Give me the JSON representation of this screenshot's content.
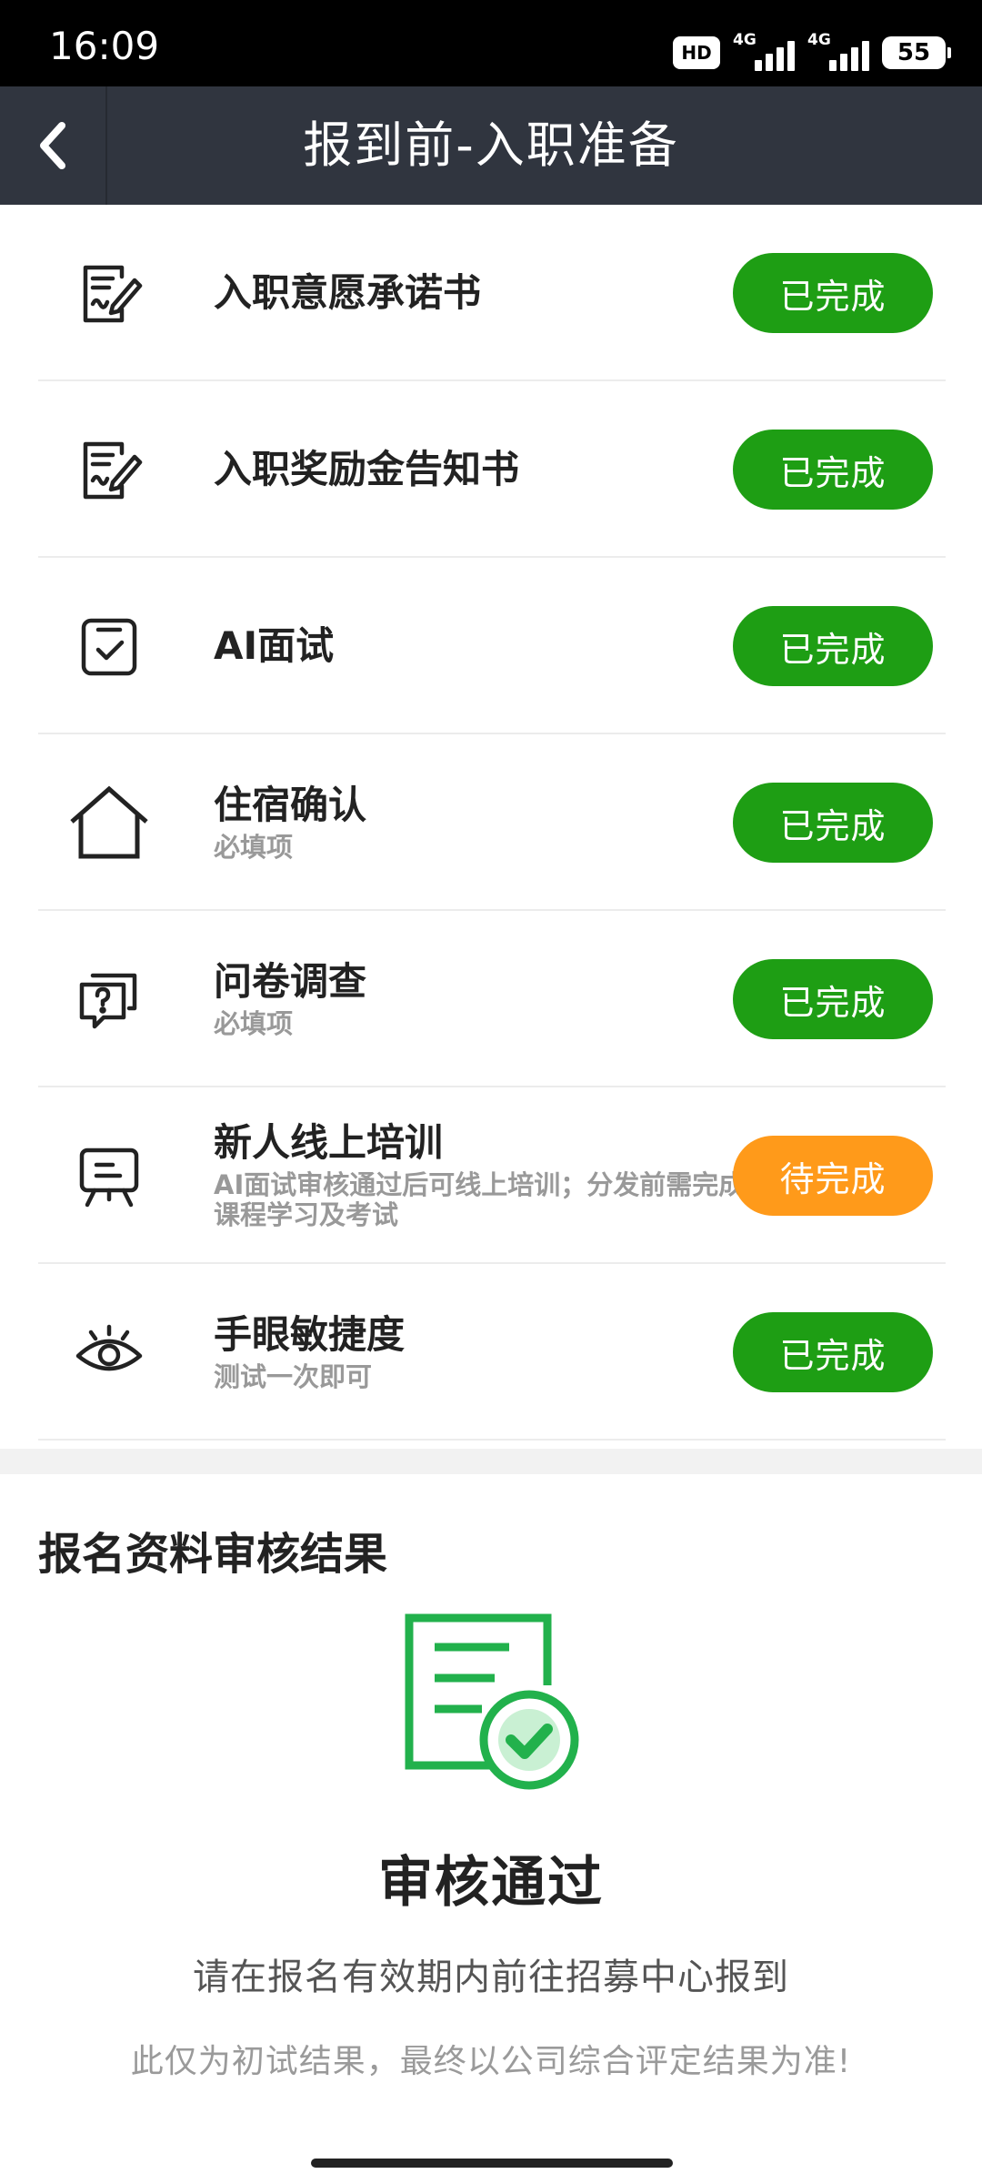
{
  "status_bar": {
    "time": "16:09",
    "hd_badge": "HD",
    "signal1_tag": "4G",
    "signal2_tag": "4G",
    "battery": "55",
    "icons": [
      "hd-icon",
      "signal-icon",
      "signal-icon",
      "battery-icon"
    ]
  },
  "nav": {
    "back_icon": "chevron-left-icon",
    "title": "报到前-入职准备"
  },
  "tasks": [
    {
      "title": "入职意愿承诺书",
      "subtitle": "",
      "status": "已完成",
      "icon": "document-sign-icon"
    },
    {
      "title": "入职奖励金告知书",
      "subtitle": "",
      "status": "已完成",
      "icon": "document-sign-icon"
    },
    {
      "title": "AI面试",
      "subtitle": "",
      "status": "已完成",
      "icon": "checkbox-icon"
    },
    {
      "title": "住宿确认",
      "subtitle": "必填项",
      "status": "已完成",
      "icon": "house-icon"
    },
    {
      "title": "问卷调查",
      "subtitle": "必填项",
      "status": "已完成",
      "icon": "question-chat-icon"
    },
    {
      "title": "新人线上培训",
      "subtitle": "AI面试审核通过后可线上培训；分发前需完成课程学习及考试",
      "status": "待完成",
      "icon": "presentation-board-icon"
    },
    {
      "title": "手眼敏捷度",
      "subtitle": "测试一次即可",
      "status": "已完成",
      "icon": "eye-icon"
    }
  ],
  "colors": {
    "done": "#1e9e14",
    "pending": "#ff9a1a",
    "nav_bg": "#30353f",
    "illustration": "#22b14c"
  },
  "review": {
    "section_title": "报名资料审核结果",
    "illustration_icon": "document-approved-icon",
    "result_title": "审核通过",
    "description": "请在报名有效期内前往招募中心报到",
    "note": "此仅为初试结果，最终以公司综合评定结果为准!"
  }
}
